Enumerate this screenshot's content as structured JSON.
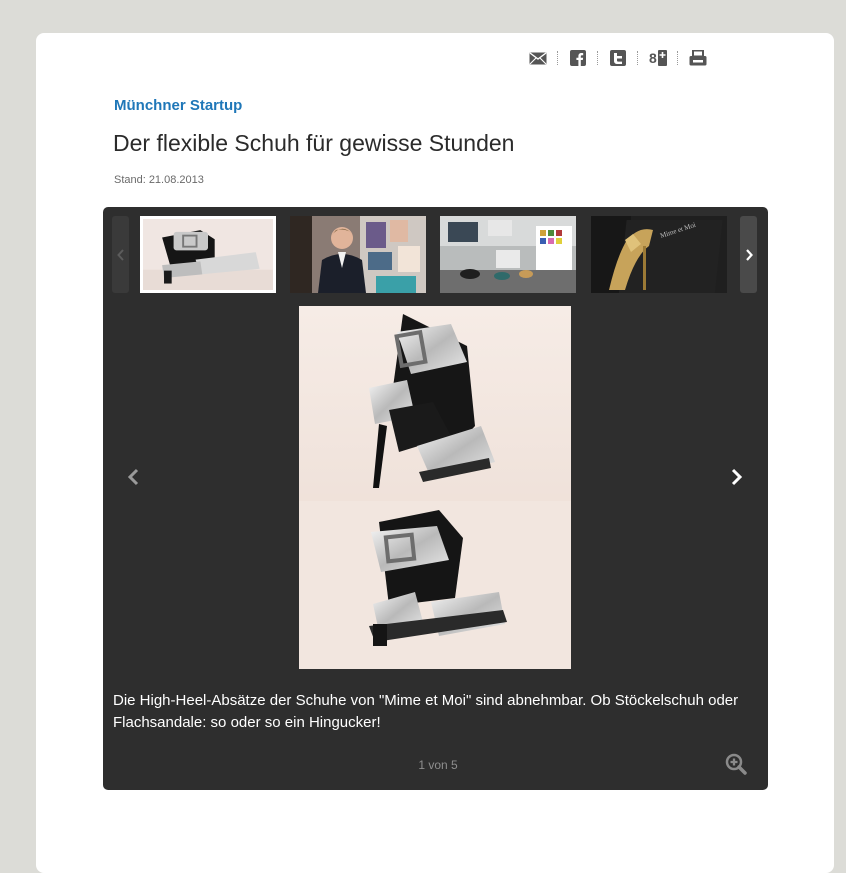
{
  "share": {
    "icons": [
      "mail-icon",
      "facebook-icon",
      "twitter-icon",
      "google-plus-icon",
      "print-icon"
    ]
  },
  "article": {
    "kicker": "Münchner Startup",
    "headline": "Der flexible Schuh für gewisse Stunden",
    "stand_label": "Stand:",
    "stand_date": "21.08.2013"
  },
  "gallery": {
    "caption": "Die High-Heel-Absätze der Schuhe von \"Mime et Moi\" sind abnehmbar. Ob Stöckelschuh oder Flachsandale: so oder so ein Hingucker!",
    "counter": "1 von 5",
    "thumbnails": [
      "shoe-flat-sandal",
      "founder-portrait",
      "showroom",
      "gold-high-heel"
    ],
    "active_index": 0
  },
  "colors": {
    "kicker": "#1f77b8",
    "gallery_bg": "#2e2e2e",
    "page_bg": "#dcdcd7"
  }
}
